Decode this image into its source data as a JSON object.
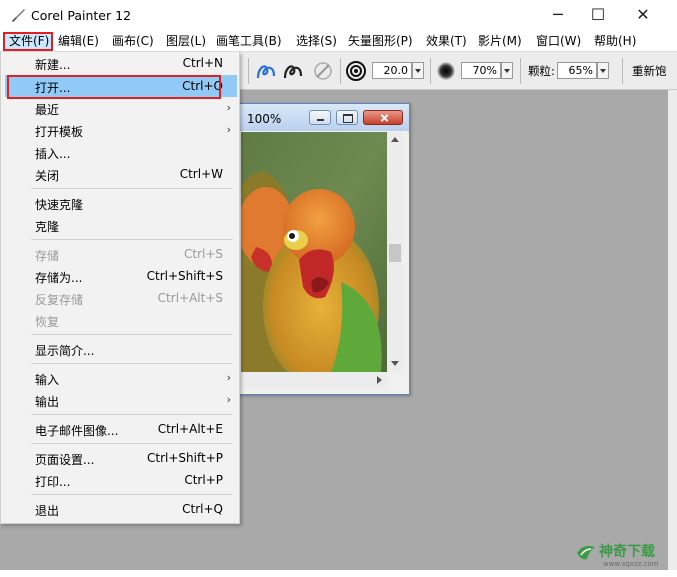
{
  "app": {
    "title": "Corel Painter 12"
  },
  "window_controls": {
    "minimize": "─",
    "maximize": "☐",
    "close": "✕"
  },
  "menubar": [
    {
      "label": "文件(F)"
    },
    {
      "label": "编辑(E)"
    },
    {
      "label": "画布(C)"
    },
    {
      "label": "图层(L)"
    },
    {
      "label": "画笔工具(B)"
    },
    {
      "label": "选择(S)"
    },
    {
      "label": "矢量图形(P)"
    },
    {
      "label": "效果(T)"
    },
    {
      "label": "影片(M)"
    },
    {
      "label": "窗口(W)"
    },
    {
      "label": "帮助(H)"
    }
  ],
  "toolbar": {
    "size_value": "20.0",
    "opacity_value": "70%",
    "grain_label": "颗粒:",
    "grain_value": "65%",
    "resaturate_label": "重新饱"
  },
  "document": {
    "zoom": "100%"
  },
  "file_menu": {
    "items": [
      {
        "label": "新建...",
        "shortcut": "Ctrl+N",
        "enabled": true,
        "submenu": false
      },
      {
        "label": "打开...",
        "shortcut": "Ctrl+O",
        "enabled": true,
        "submenu": false,
        "highlighted": true
      },
      {
        "label": "最近",
        "shortcut": "",
        "enabled": true,
        "submenu": true
      },
      {
        "label": "打开模板",
        "shortcut": "",
        "enabled": true,
        "submenu": true
      },
      {
        "label": "插入...",
        "shortcut": "",
        "enabled": true,
        "submenu": false
      },
      {
        "label": "关闭",
        "shortcut": "Ctrl+W",
        "enabled": true,
        "submenu": false
      },
      {
        "label": "快速克隆",
        "shortcut": "",
        "enabled": true,
        "submenu": false
      },
      {
        "label": "克隆",
        "shortcut": "",
        "enabled": true,
        "submenu": false
      },
      {
        "label": "存储",
        "shortcut": "Ctrl+S",
        "enabled": false,
        "submenu": false
      },
      {
        "label": "存储为...",
        "shortcut": "Ctrl+Shift+S",
        "enabled": true,
        "submenu": false
      },
      {
        "label": "反复存储",
        "shortcut": "Ctrl+Alt+S",
        "enabled": false,
        "submenu": false
      },
      {
        "label": "恢复",
        "shortcut": "",
        "enabled": false,
        "submenu": false
      },
      {
        "label": "显示简介...",
        "shortcut": "",
        "enabled": true,
        "submenu": false
      },
      {
        "label": "输入",
        "shortcut": "",
        "enabled": true,
        "submenu": true
      },
      {
        "label": "输出",
        "shortcut": "",
        "enabled": true,
        "submenu": true
      },
      {
        "label": "电子邮件图像...",
        "shortcut": "Ctrl+Alt+E",
        "enabled": true,
        "submenu": false
      },
      {
        "label": "页面设置...",
        "shortcut": "Ctrl+Shift+P",
        "enabled": true,
        "submenu": false
      },
      {
        "label": "打印...",
        "shortcut": "Ctrl+P",
        "enabled": true,
        "submenu": false
      },
      {
        "label": "退出",
        "shortcut": "Ctrl+Q",
        "enabled": true,
        "submenu": false
      }
    ],
    "submenu_arrow": "›"
  },
  "watermark": {
    "brand": "神奇下载",
    "url": "www.sqxzz.com"
  },
  "colors": {
    "highlight": "#91c9f7",
    "annotation": "#e02020",
    "workspace": "#a9a9a9"
  }
}
